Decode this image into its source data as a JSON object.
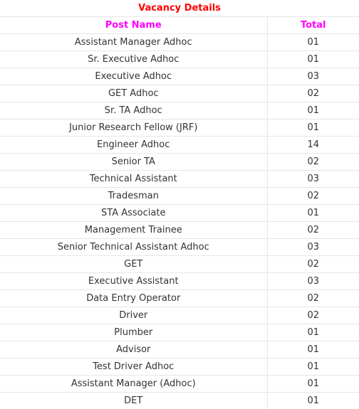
{
  "table": {
    "title": "Vacancy Details",
    "headers": [
      "Post Name",
      "Total"
    ],
    "rows": [
      {
        "post": "Assistant Manager Adhoc",
        "total": "01"
      },
      {
        "post": "Sr. Executive Adhoc",
        "total": "01"
      },
      {
        "post": "Executive Adhoc",
        "total": "03"
      },
      {
        "post": "GET Adhoc",
        "total": "02"
      },
      {
        "post": "Sr. TA Adhoc",
        "total": "01"
      },
      {
        "post": "Junior Research Fellow (JRF)",
        "total": "01"
      },
      {
        "post": "Engineer Adhoc",
        "total": "14"
      },
      {
        "post": "Senior TA",
        "total": "02"
      },
      {
        "post": "Technical Assistant",
        "total": "03"
      },
      {
        "post": "Tradesman",
        "total": "02"
      },
      {
        "post": "STA Associate",
        "total": "01"
      },
      {
        "post": "Management Trainee",
        "total": "02"
      },
      {
        "post": "Senior Technical Assistant Adhoc",
        "total": "03"
      },
      {
        "post": "GET",
        "total": "02"
      },
      {
        "post": "Executive Assistant",
        "total": "03"
      },
      {
        "post": "Data Entry Operator",
        "total": "02"
      },
      {
        "post": "Driver",
        "total": "02"
      },
      {
        "post": "Plumber",
        "total": "01"
      },
      {
        "post": "Advisor",
        "total": "01"
      },
      {
        "post": "Test Driver Adhoc",
        "total": "01"
      },
      {
        "post": "Assistant Manager (Adhoc)",
        "total": "01"
      },
      {
        "post": "DET",
        "total": "01"
      }
    ]
  },
  "colors": {
    "title": "#ff0000",
    "header": "#ff00ff",
    "text": "#333333",
    "border": "#e6e6e6"
  }
}
